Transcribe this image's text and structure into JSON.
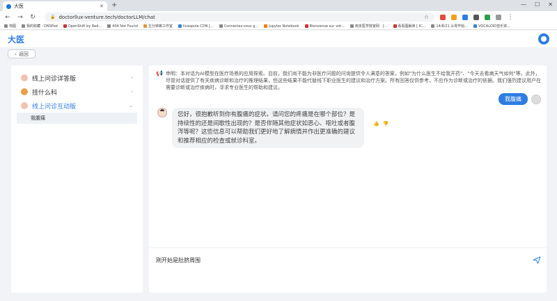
{
  "browser": {
    "tab_title": "大医",
    "url": "doctorllux-venture.tech/doctorLLM/chat",
    "bookmarks": [
      "地图",
      "我的收藏 - DNSPod",
      "OpenShift by Red...",
      "404 Not Found",
      "五分钟离工作室",
      "Iivaapule CDN [...",
      "Connectez-vous g...",
      "Jupyter Notebook",
      "Bienvenue sur vot...",
      "南京医学院官网 - [...",
      "看看图解读 [.IC...",
      "14/8/21 从零开始...",
      "VOCALOID音乐资..."
    ]
  },
  "app": {
    "logo": "大医",
    "back_label": "返回"
  },
  "sidebar": {
    "items": [
      {
        "label": "线上问诊详答版"
      },
      {
        "label": "挂什么科"
      },
      {
        "label": "线上问诊互动版"
      }
    ],
    "sub_items": [
      {
        "label": "我腹痛"
      }
    ]
  },
  "chat": {
    "notice": "申明：本对话为AI模型在医疗场景的应用探索。目前，我们尚不能为非医疗问题的问询提供令人满意的答案，例如\"为什么医生不给我开药\"、\"今天去看病天气如何\"等。此外，尽管对话提供了有关疾病诊断和治疗的推理结果，但这些结果不能代替线下职业医生的建议和治疗方案。所有回答仅供参考，不应作为诊断或治疗的依据。我们强烈建议用户在需要诊断或治疗疾病时，寻求专业医生的帮助和建议。",
    "user_message": "我腹痛",
    "bot_message": "您好，很抱歉听到你有腹痛的症状。请问您的疼痛是在哪个部位？是持续性的还是间歇性出现的？是否伴随其他症状如恶心、呕吐或者腹泻等呢？这些信息可以帮助我们更好地了解病情并作出更准确的建议和推荐相应的检查或就诊科室。",
    "input_value": "刚开始是肚脐周围"
  }
}
